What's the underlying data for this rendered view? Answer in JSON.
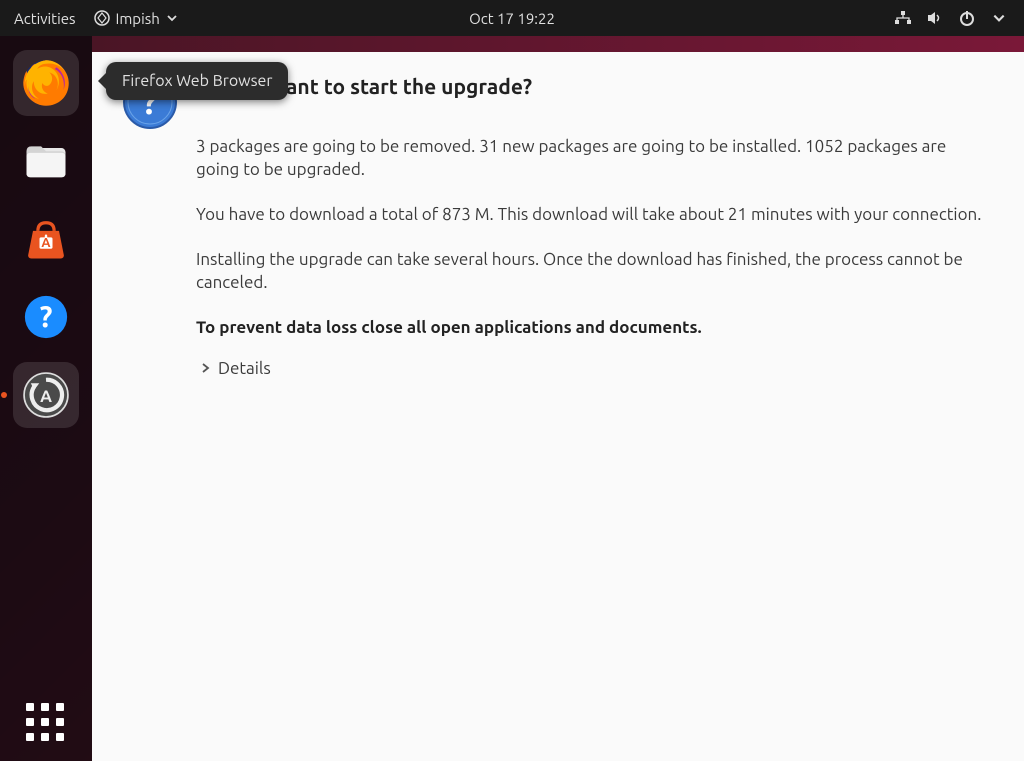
{
  "topbar": {
    "activities": "Activities",
    "app_menu_label": "Impish",
    "clock": "Oct 17  19:22"
  },
  "tooltip": {
    "text": "Firefox Web Browser"
  },
  "dock": {
    "items": [
      {
        "name": "firefox",
        "active": true
      },
      {
        "name": "files",
        "active": false
      },
      {
        "name": "software",
        "active": false
      },
      {
        "name": "help",
        "active": false
      },
      {
        "name": "software-updater",
        "active": true
      }
    ]
  },
  "dialog": {
    "title": "Do you want to start the upgrade?",
    "paragraph1": "3 packages are going to be removed. 31 new packages are going to be installed. 1052 packages are going to be upgraded.",
    "paragraph2": "You have to download a total of 873 M. This download will take about 21 minutes with your connection.",
    "paragraph3": "Installing the upgrade can take several hours. Once the download has finished, the process cannot be canceled.",
    "warning": "To prevent data loss close all open applications and documents.",
    "details_label": "Details"
  }
}
